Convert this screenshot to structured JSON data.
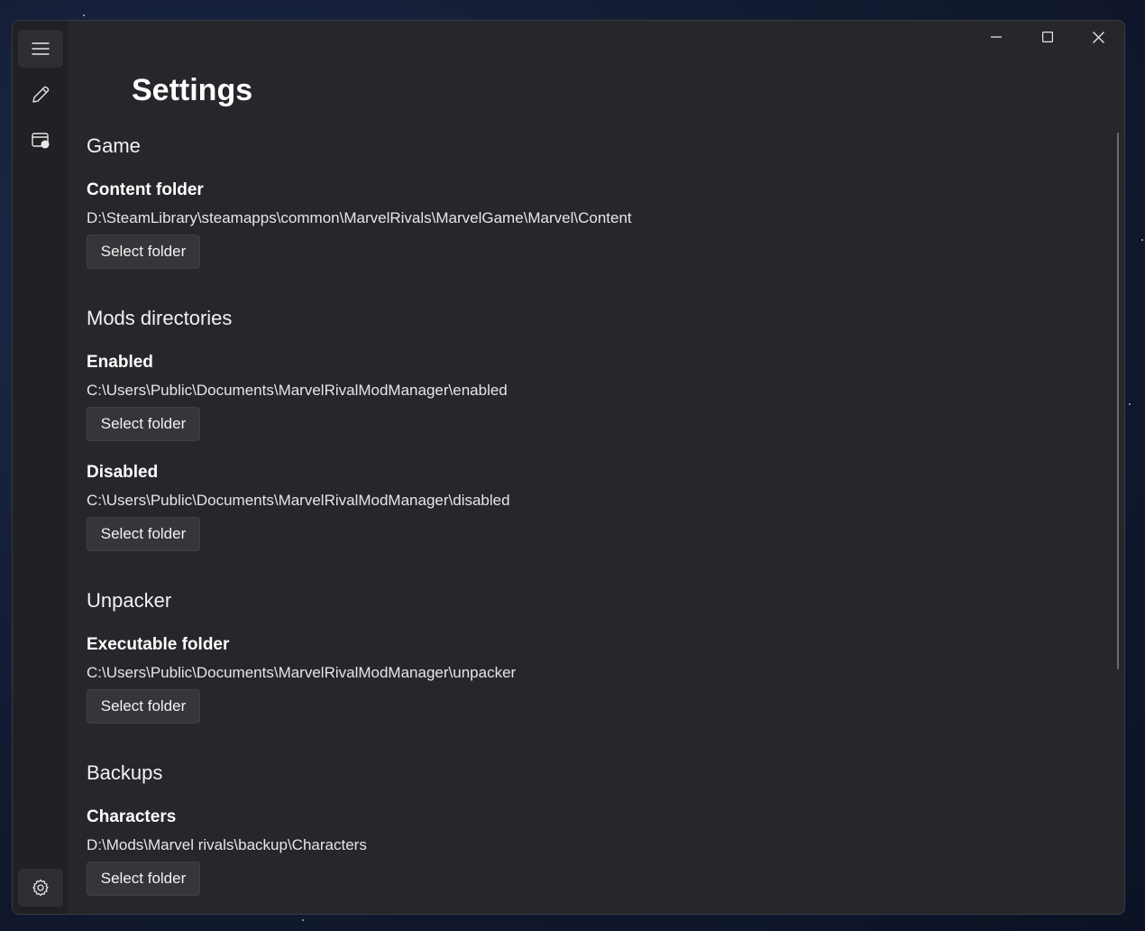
{
  "window": {
    "title": "Settings",
    "caption": {
      "minimize_icon": "minimize-icon",
      "maximize_icon": "maximize-icon",
      "close_icon": "close-icon"
    }
  },
  "nav": {
    "items": [
      {
        "icon": "hamburger-menu-icon"
      },
      {
        "icon": "pencil-icon"
      },
      {
        "icon": "mods-library-icon"
      },
      {
        "icon": "gear-icon",
        "selected": true
      }
    ]
  },
  "sections": {
    "game": {
      "title": "Game",
      "content_folder": {
        "label": "Content folder",
        "path": "D:\\SteamLibrary\\steamapps\\common\\MarvelRivals\\MarvelGame\\Marvel\\Content",
        "button": "Select folder"
      }
    },
    "mods": {
      "title": "Mods directories",
      "enabled": {
        "label": "Enabled",
        "path": "C:\\Users\\Public\\Documents\\MarvelRivalModManager\\enabled",
        "button": "Select folder"
      },
      "disabled": {
        "label": "Disabled",
        "path": "C:\\Users\\Public\\Documents\\MarvelRivalModManager\\disabled",
        "button": "Select folder"
      }
    },
    "unpacker": {
      "title": "Unpacker",
      "executable_folder": {
        "label": "Executable folder",
        "path": "C:\\Users\\Public\\Documents\\MarvelRivalModManager\\unpacker",
        "button": "Select folder"
      }
    },
    "backups": {
      "title": "Backups",
      "characters": {
        "label": "Characters",
        "path": "D:\\Mods\\Marvel rivals\\backup\\Characters",
        "button": "Select folder"
      }
    }
  },
  "colors": {
    "window_bg": "#26272b",
    "nav_bg": "#202124",
    "button_bg": "#35363a",
    "text": "#ffffff"
  }
}
